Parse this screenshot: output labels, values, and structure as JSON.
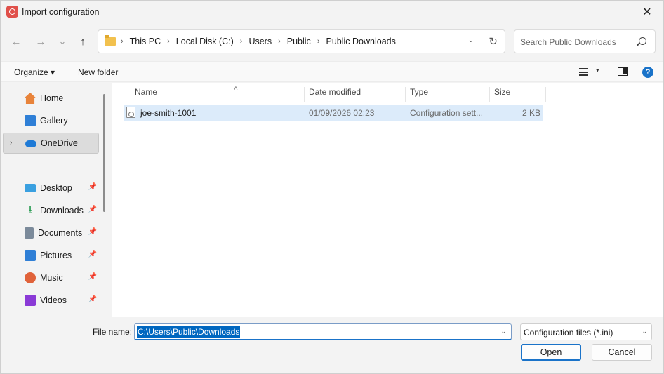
{
  "window": {
    "title": "Import configuration",
    "close": "✕"
  },
  "nav": {
    "back": "←",
    "forward": "→",
    "recent": "⌄",
    "up": "↑"
  },
  "address": {
    "crumbs": [
      "This PC",
      "Local Disk (C:)",
      "Users",
      "Public",
      "Public Downloads"
    ],
    "sep": "›",
    "dropdown": "⌄",
    "refresh": "↻"
  },
  "search": {
    "placeholder": "Search Public Downloads"
  },
  "toolbar": {
    "organize": "Organize ▾",
    "new_folder": "New folder",
    "view_dd": "▾",
    "help": "?"
  },
  "sidebar": {
    "items": [
      {
        "label": "Home",
        "icon": "home-icon",
        "color": "#e8833a"
      },
      {
        "label": "Gallery",
        "icon": "gallery-icon",
        "color": "#2f7fd6"
      },
      {
        "label": "OneDrive",
        "icon": "cloud-icon",
        "color": "#1e7ad6",
        "selected": true,
        "chevron": "›"
      },
      {
        "label": "Desktop",
        "icon": "desktop-icon",
        "color": "#3aa0e0",
        "pin": "📌"
      },
      {
        "label": "Downloads",
        "icon": "download-icon",
        "color": "#2e9e57",
        "pin": "📌"
      },
      {
        "label": "Documents",
        "icon": "document-icon",
        "color": "#7b8a9a",
        "pin": "📌"
      },
      {
        "label": "Pictures",
        "icon": "pictures-icon",
        "color": "#2f7fd6",
        "pin": "📌"
      },
      {
        "label": "Music",
        "icon": "music-icon",
        "color": "#e0623a",
        "pin": "📌"
      },
      {
        "label": "Videos",
        "icon": "video-icon",
        "color": "#8a3ad6",
        "pin": "📌"
      }
    ]
  },
  "table": {
    "columns": [
      "Name",
      "Date modified",
      "Type",
      "Size"
    ],
    "sort_arrow": "˄",
    "rows": [
      {
        "name": "joe-smith-1001",
        "date": "01/09/2026 02:23",
        "type": "Configuration sett...",
        "size": "2 KB"
      }
    ]
  },
  "footer": {
    "file_name_label": "File name:",
    "file_name_value": "C:\\Users\\Public\\Downloads",
    "dropdown": "⌄",
    "file_type": "Configuration files (*.ini)",
    "open": "Open",
    "cancel": "Cancel"
  }
}
